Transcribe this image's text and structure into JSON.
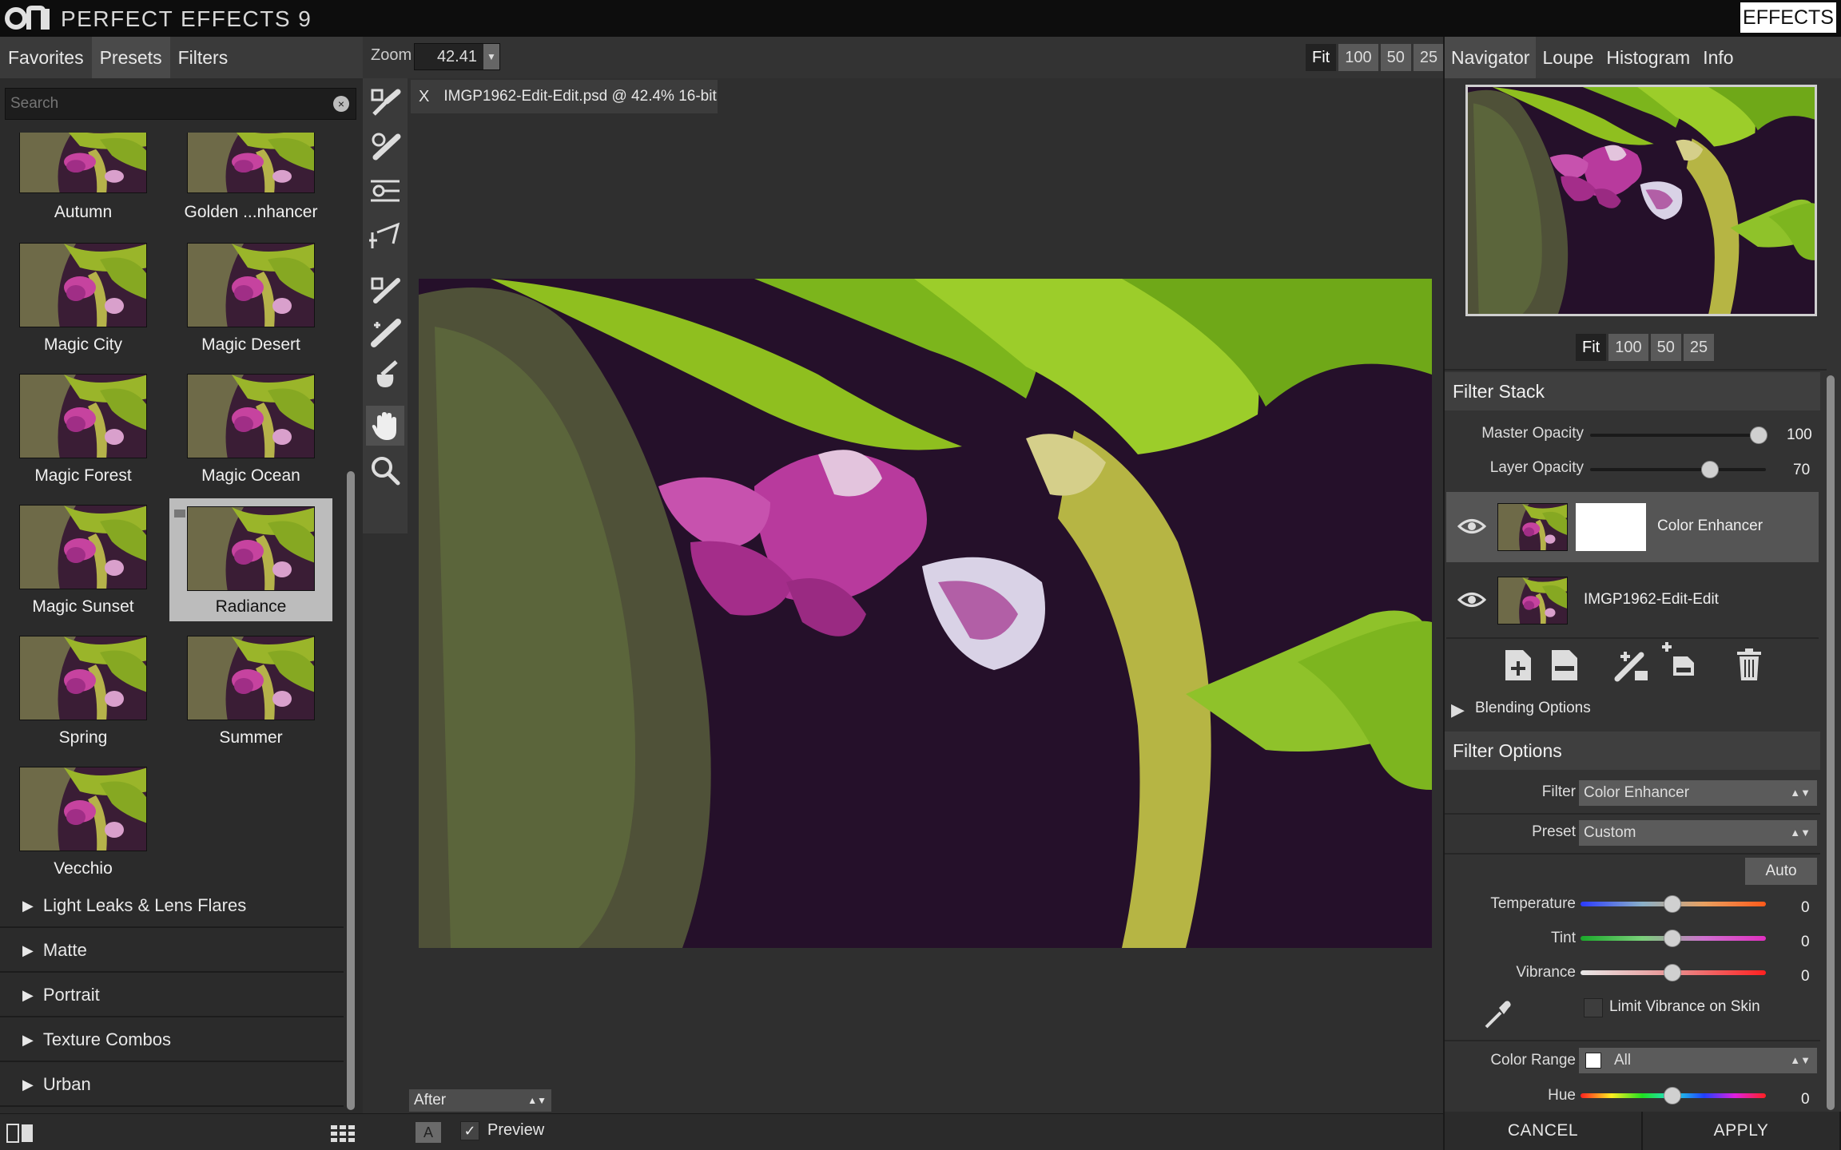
{
  "app": {
    "title": "PERFECT EFFECTS 9",
    "effects_button": "EFFECTS"
  },
  "left_panel": {
    "tabs": [
      {
        "label": "Favorites"
      },
      {
        "label": "Presets"
      },
      {
        "label": "Filters"
      }
    ],
    "active_tab": "Presets",
    "search": {
      "placeholder": "Search",
      "value": ""
    },
    "presets": [
      {
        "name": "Autumn"
      },
      {
        "name": "Golden ...nhancer"
      },
      {
        "name": "Magic City"
      },
      {
        "name": "Magic Desert"
      },
      {
        "name": "Magic Forest"
      },
      {
        "name": "Magic Ocean"
      },
      {
        "name": "Magic Sunset"
      },
      {
        "name": "Radiance"
      },
      {
        "name": "Spring"
      },
      {
        "name": "Summer"
      },
      {
        "name": "Vecchio"
      }
    ],
    "selected_preset": "Radiance",
    "categories": [
      {
        "label": "Light Leaks & Lens Flares"
      },
      {
        "label": "Matte"
      },
      {
        "label": "Portrait"
      },
      {
        "label": "Texture Combos"
      },
      {
        "label": "Urban"
      }
    ]
  },
  "toolbar": {
    "zoom_label": "Zoom",
    "zoom_value": "42.41",
    "zoom_buttons": [
      {
        "label": "Fit"
      },
      {
        "label": "100"
      },
      {
        "label": "50"
      },
      {
        "label": "25"
      }
    ]
  },
  "document": {
    "tab_close": "X",
    "tab_title": "IMGP1962-Edit-Edit.psd @ 42.4% 16-bit"
  },
  "view": {
    "mode": "After",
    "a_label": "A",
    "preview_label": "Preview",
    "preview_checked": true
  },
  "right_panel": {
    "tabs": [
      {
        "label": "Navigator"
      },
      {
        "label": "Loupe"
      },
      {
        "label": "Histogram"
      },
      {
        "label": "Info"
      }
    ],
    "active_tab": "Navigator",
    "nav_zoom_buttons": [
      {
        "label": "Fit"
      },
      {
        "label": "100"
      },
      {
        "label": "50"
      },
      {
        "label": "25"
      }
    ],
    "filter_stack": {
      "title": "Filter Stack",
      "master_opacity": {
        "label": "Master Opacity",
        "value": 100
      },
      "layer_opacity": {
        "label": "Layer Opacity",
        "value": 70
      },
      "layers": [
        {
          "name": "Color Enhancer"
        },
        {
          "name": "IMGP1962-Edit-Edit"
        }
      ],
      "blending_label": "Blending Options"
    },
    "filter_options": {
      "title": "Filter Options",
      "filter_label": "Filter",
      "filter_value": "Color Enhancer",
      "preset_label": "Preset",
      "preset_value": "Custom",
      "auto_label": "Auto",
      "sliders": [
        {
          "label": "Temperature",
          "value": 0
        },
        {
          "label": "Tint",
          "value": 0
        },
        {
          "label": "Vibrance",
          "value": 0
        }
      ],
      "limit_vibrance_label": "Limit Vibrance on Skin",
      "color_range_label": "Color Range",
      "color_range_value": "All",
      "hue": {
        "label": "Hue",
        "value": 0
      }
    },
    "cancel_label": "CANCEL",
    "apply_label": "APPLY"
  }
}
